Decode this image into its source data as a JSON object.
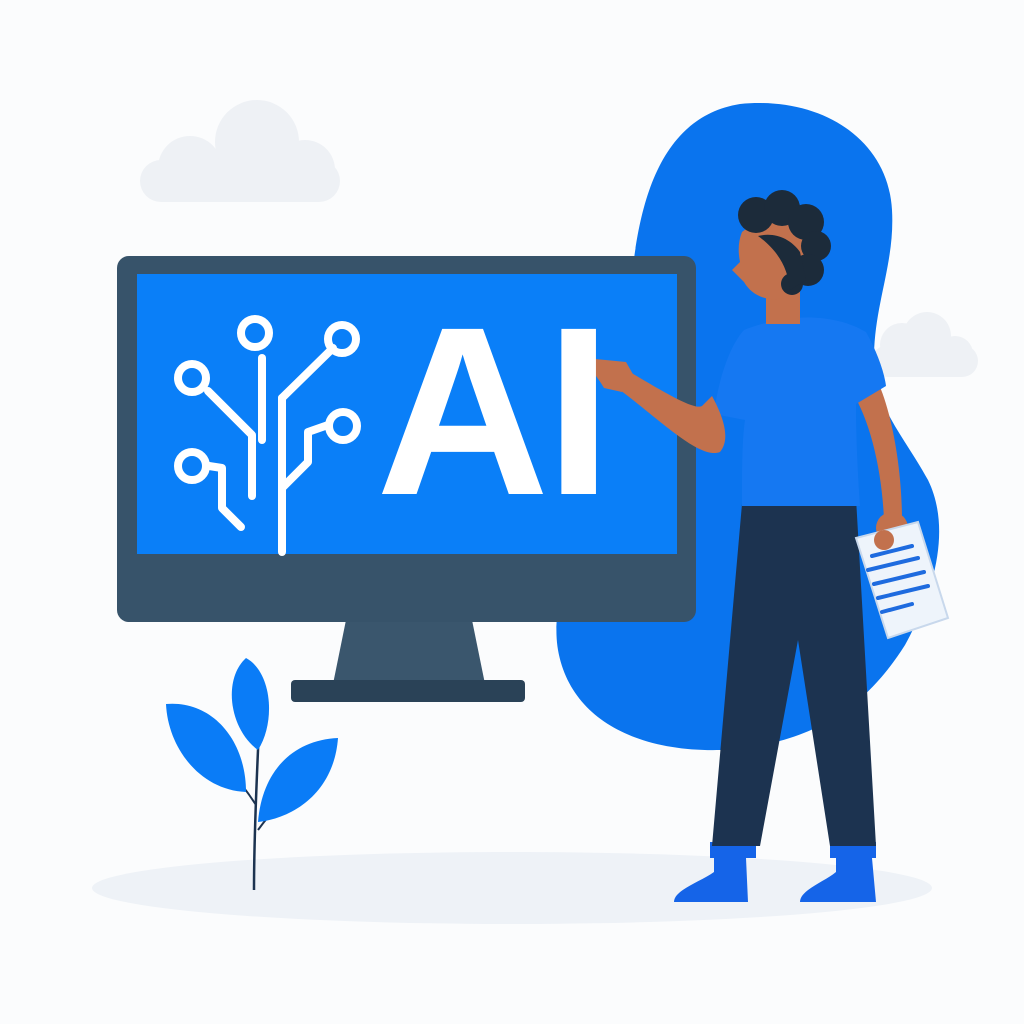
{
  "screen": {
    "headline": "AI"
  },
  "colors": {
    "background": "#fbfcfd",
    "accent_blue": "#0a7cf7",
    "blob_blue": "#0a74ee",
    "monitor_frame": "#37536a",
    "monitor_stand": "#3a566d",
    "monitor_base": "#2a4257",
    "screen_blue": "#0a7ff8",
    "skin": "#c2714d",
    "hair": "#1c2b3a",
    "pants": "#1c3350",
    "shirt": "#1578f2",
    "shoes": "#1564e8",
    "cloud": "#eef1f5",
    "ground": "#eef2f7",
    "document": "#eef4fb",
    "document_lines": "#1e6bdf"
  },
  "icons": {
    "circuit": "circuit-tree-icon",
    "plant": "leaf-plant-icon",
    "document": "document-icon"
  }
}
